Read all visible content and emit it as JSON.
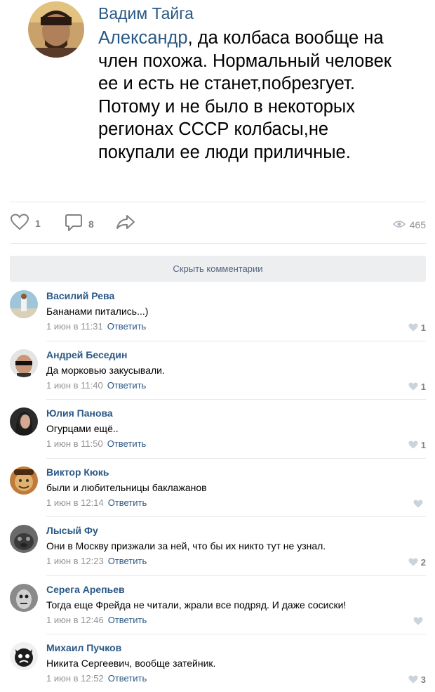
{
  "post": {
    "author": "Вадим Тайга",
    "mention": "Александр",
    "text": ", да колбаса вообще на член похожа. Нормальный человек ее и есть не станет,побрезгует. Потому и не было в некоторых регионах СССР колбасы,не покупали ее люди приличные.",
    "likes": "1",
    "comments": "8",
    "views": "465"
  },
  "hide_comments_label": "Скрыть комментарии",
  "reply_label": "Ответить",
  "colors": {
    "link": "#2a5885",
    "meta": "#939393",
    "icon": "#828282",
    "button_bg": "#edeef0",
    "separator": "#e7e8ec"
  },
  "comments": [
    {
      "name": "Василий Рева",
      "text": "Бананами питались...)",
      "date": "1 июн в 11:31",
      "likes": "1"
    },
    {
      "name": "Андрей Беседин",
      "text": "Да морковью закусывали.",
      "date": "1 июн в 11:40",
      "likes": "1"
    },
    {
      "name": "Юлия Панова",
      "text": "Огурцами ещё..",
      "date": "1 июн в 11:50",
      "likes": "1"
    },
    {
      "name": "Виктор Кюкь",
      "text": "были и любительницы баклажанов",
      "date": "1 июн в 12:14",
      "likes": ""
    },
    {
      "name": "Лысый Фу",
      "text": "Они в Москву призжали за ней, что бы их никто тут не узнал.",
      "date": "1 июн в 12:23",
      "likes": "2"
    },
    {
      "name": "Серега Арепьев",
      "text": "Тогда еще Фрейда не читали, жрали все подряд. И даже сосиски!",
      "date": "1 июн в 12:46",
      "likes": ""
    },
    {
      "name": "Михаил Пучков",
      "text": "Никита Сергеевич, вообще затейник.",
      "date": "1 июн в 12:52",
      "likes": "3"
    }
  ]
}
